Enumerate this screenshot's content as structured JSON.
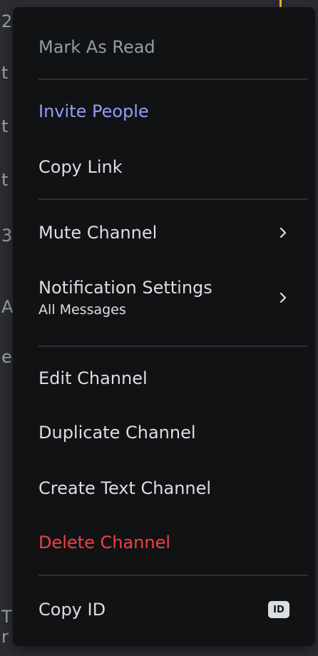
{
  "menu": {
    "mark_as_read": "Mark As Read",
    "invite_people": "Invite People",
    "copy_link": "Copy Link",
    "mute_channel": "Mute Channel",
    "notification_settings": "Notification Settings",
    "notification_settings_sub": "All Messages",
    "edit_channel": "Edit Channel",
    "duplicate_channel": "Duplicate Channel",
    "create_text_channel": "Create Text Channel",
    "delete_channel": "Delete Channel",
    "copy_id": "Copy ID",
    "id_badge": "ID"
  },
  "background_glyphs": [
    "2",
    "t",
    "t",
    "t",
    "3",
    "A",
    "e",
    "T",
    "r"
  ],
  "icons": {
    "mute_submenu": "chevron-right-icon",
    "notification_submenu": "chevron-right-icon",
    "copy_id": "id-badge-icon"
  },
  "colors": {
    "menu_bg": "#111214",
    "text": "#dbdee1",
    "muted": "#949ba4",
    "accent": "#949cf7",
    "danger": "#f23f43",
    "separator": "#2e3035"
  }
}
